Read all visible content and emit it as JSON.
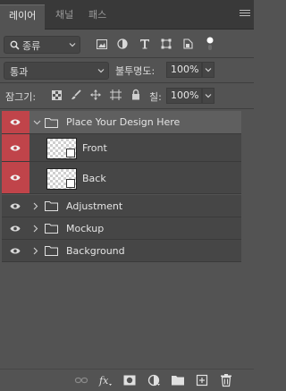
{
  "tabs": [
    "레이어",
    "채널",
    "패스"
  ],
  "filter": {
    "label": "종류"
  },
  "blend": {
    "mode": "통과",
    "opacity_label": "불투명도:",
    "opacity_value": "100%"
  },
  "lock": {
    "label": "잠그기:",
    "fill_label": "칠:",
    "fill_value": "100%"
  },
  "layers": [
    {
      "name": "Place Your Design Here",
      "type": "group",
      "expanded": true,
      "selected": true,
      "visible": true,
      "eye_highlight": true
    },
    {
      "name": "Front",
      "type": "smart-object",
      "visible": true,
      "eye_highlight": true
    },
    {
      "name": "Back",
      "type": "smart-object",
      "visible": true,
      "eye_highlight": true
    },
    {
      "name": "Adjustment",
      "type": "group",
      "expanded": false,
      "visible": true
    },
    {
      "name": "Mockup",
      "type": "group",
      "expanded": false,
      "visible": true
    },
    {
      "name": "Background",
      "type": "group",
      "expanded": false,
      "visible": true
    }
  ],
  "bottom_icons": [
    "link-icon",
    "fx-icon",
    "mask-icon",
    "adjustment-icon",
    "new-group-icon",
    "new-layer-icon",
    "trash-icon"
  ],
  "colors": {
    "eye_highlight": "#c0444a",
    "panel": "#535353",
    "tabbar": "#393939",
    "row": "#464646",
    "selected_row": "#5f5f5f"
  }
}
